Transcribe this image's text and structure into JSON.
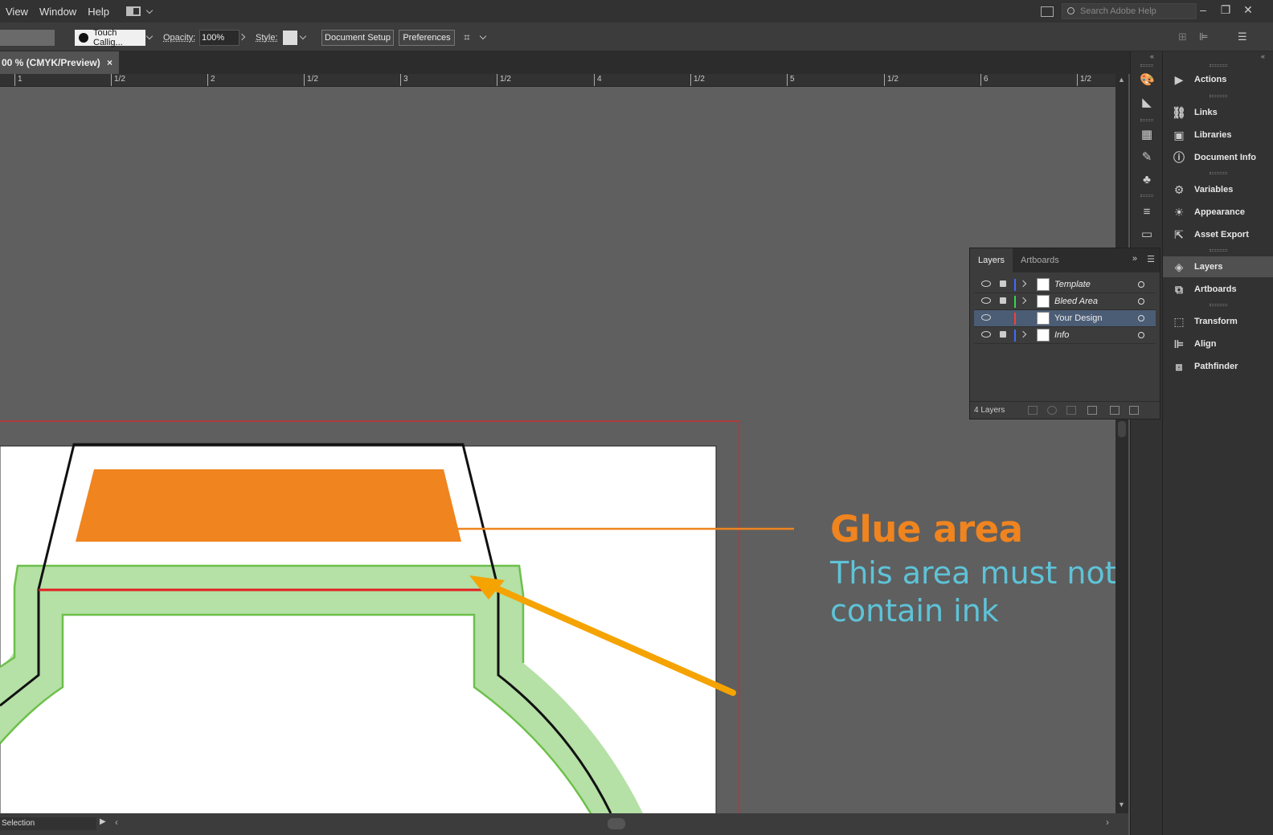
{
  "menubar": {
    "items": [
      "View",
      "Window",
      "Help"
    ],
    "search_placeholder": "Search Adobe Help"
  },
  "controlbar": {
    "brush": "Touch Callig...",
    "opacity_label": "Opacity:",
    "opacity_value": "100%",
    "style_label": "Style:",
    "document_setup": "Document Setup",
    "preferences": "Preferences"
  },
  "doc_tab": {
    "title": "00 % (CMYK/Preview)",
    "close": "×"
  },
  "ruler": {
    "ticks": [
      "1",
      "1/2",
      "2",
      "1/2",
      "3",
      "1/2",
      "4",
      "1/2",
      "5",
      "1/2",
      "6",
      "1/2"
    ]
  },
  "layers_panel": {
    "tabs": [
      "Layers",
      "Artboards"
    ],
    "layers": [
      {
        "name": "Template",
        "color": "#3d6bff",
        "locked": true,
        "expandable": true,
        "selected": false
      },
      {
        "name": "Bleed Area",
        "color": "#36d64a",
        "locked": true,
        "expandable": true,
        "selected": false
      },
      {
        "name": "Your Design",
        "color": "#ff3b3b",
        "locked": false,
        "expandable": false,
        "selected": true
      },
      {
        "name": "Info",
        "color": "#3d6bff",
        "locked": true,
        "expandable": true,
        "selected": false
      }
    ],
    "count_label": "4 Layers"
  },
  "right_dock": {
    "items": [
      "Actions",
      "Links",
      "Libraries",
      "Document Info",
      "Variables",
      "Appearance",
      "Asset Export",
      "Layers",
      "Artboards",
      "Transform",
      "Align",
      "Pathfinder"
    ],
    "active": "Layers"
  },
  "annotation": {
    "title": "Glue area",
    "subtitle": "This area must not contain ink",
    "title_color": "#f0841f",
    "subtitle_color": "#5ec3d8"
  },
  "status_bar": {
    "tool": "Selection"
  }
}
